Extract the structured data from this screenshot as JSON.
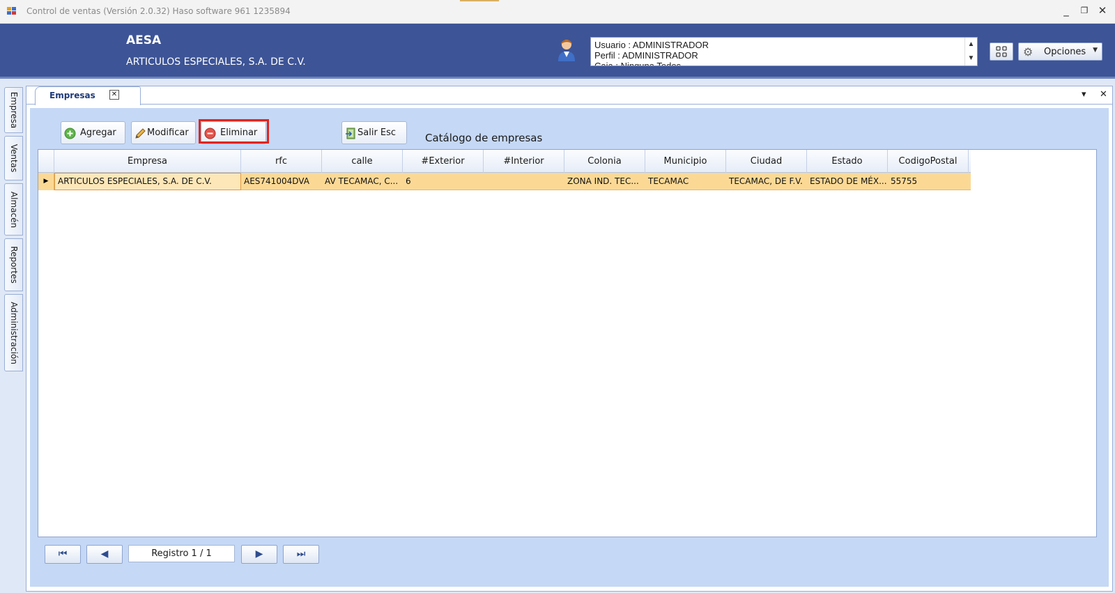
{
  "window": {
    "title": "Control de ventas  (Versión 2.0.32)  Haso software  961 1235894",
    "minimize": "_",
    "restore": "❐",
    "close": "✕"
  },
  "header": {
    "company_short": "AESA",
    "company_name": "ARTICULOS ESPECIALES, S.A. DE C.V.",
    "user_lines": [
      "Usuario : ADMINISTRADOR",
      "Perfil : ADMINISTRADOR",
      "Caja : Ninguna   Todos"
    ],
    "options_label": "Opciones"
  },
  "sidebar": {
    "tabs": [
      "Empresa",
      "Ventas",
      "Almacén",
      "Reportes",
      "Administración"
    ]
  },
  "document": {
    "tab_label": "Empresas",
    "tab_close": "✕",
    "strip_menu": "▾",
    "strip_close": "✕"
  },
  "toolbar": {
    "add_label": "Agregar",
    "edit_label": "Modificar",
    "delete_label": "Eliminar",
    "exit_label": "Salir  Esc",
    "catalog_title": "Catálogo de empresas"
  },
  "grid": {
    "columns": [
      "Empresa",
      "rfc",
      "calle",
      "#Exterior",
      "#Interior",
      "Colonia",
      "Municipio",
      "Ciudad",
      "Estado",
      "CodigoPostal"
    ],
    "rows": [
      [
        "ARTICULOS ESPECIALES, S.A. DE C.V.",
        "AES741004DVA",
        "AV TECAMAC, C...",
        "6",
        "",
        "ZONA IND. TEC...",
        "TECAMAC",
        "TECAMAC, DE F.V.",
        "ESTADO DE MÉX...",
        "55755"
      ]
    ]
  },
  "pager": {
    "record_text": "Registro  1 / 1"
  },
  "colors": {
    "header_bg": "#3d5496",
    "selected_row": "#fbd995",
    "highlight": "#e0241c",
    "content_bg": "#c5d8f5"
  }
}
